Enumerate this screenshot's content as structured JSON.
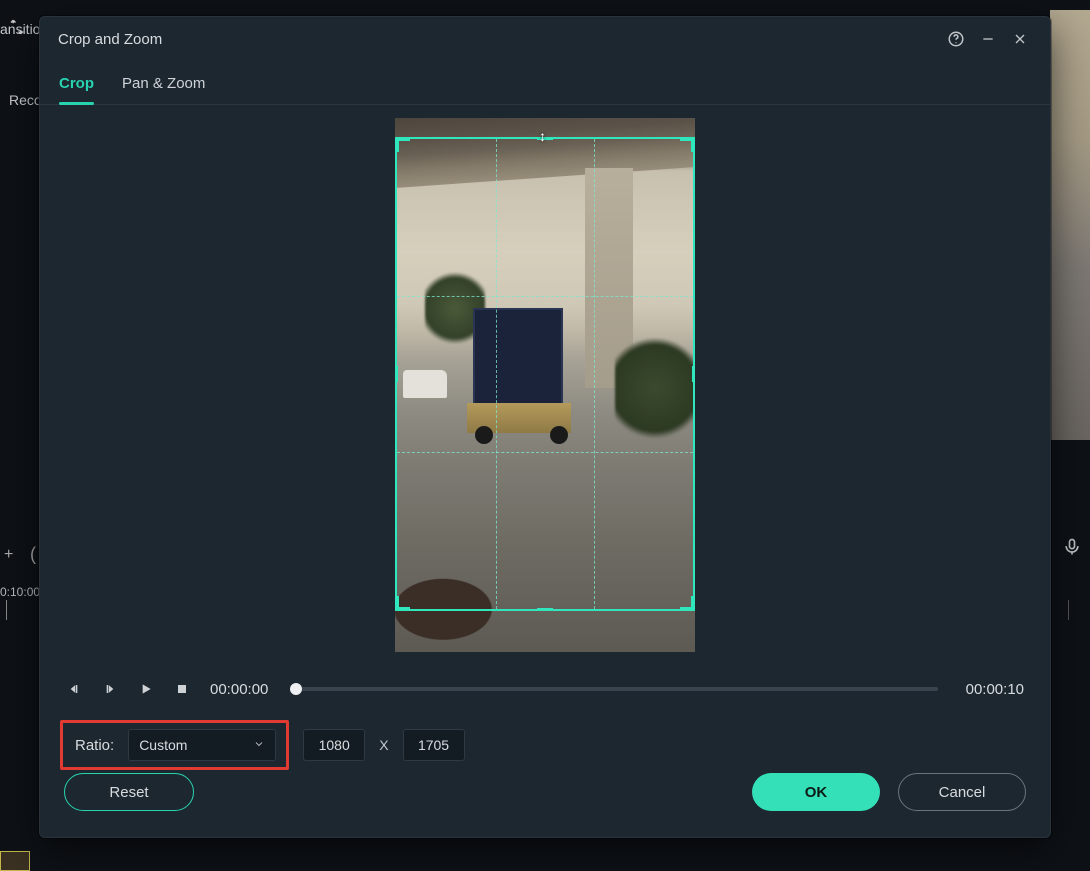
{
  "bg": {
    "tab_transitions": "ansitions",
    "tab_record": "Reco",
    "timecode_left": "0:10:00",
    "plus": "+",
    "paren": "("
  },
  "dialog": {
    "title": "Crop and Zoom",
    "tabs": {
      "crop": "Crop",
      "panzoom": "Pan & Zoom"
    },
    "controls": {
      "time_current": "00:00:00",
      "time_total": "00:00:10"
    },
    "ratio": {
      "label": "Ratio:",
      "selected": "Custom",
      "width": "1080",
      "sep": "X",
      "height": "1705"
    },
    "buttons": {
      "reset": "Reset",
      "ok": "OK",
      "cancel": "Cancel"
    }
  }
}
